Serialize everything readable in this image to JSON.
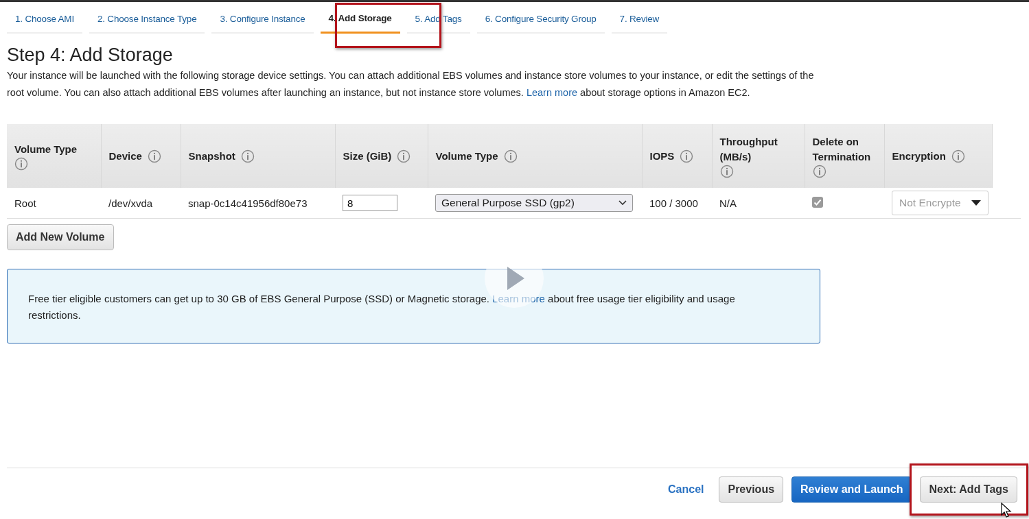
{
  "tabs": [
    {
      "label": "1. Choose AMI",
      "selected": false
    },
    {
      "label": "2. Choose Instance Type",
      "selected": false
    },
    {
      "label": "3. Configure Instance",
      "selected": false
    },
    {
      "label": "4. Add Storage",
      "selected": true
    },
    {
      "label": "5. Add Tags",
      "selected": false
    },
    {
      "label": "6. Configure Security Group",
      "selected": false
    },
    {
      "label": "7. Review",
      "selected": false
    }
  ],
  "title": "Step 4: Add Storage",
  "description": {
    "before": "Your instance will be launched with the following storage device settings. You can attach additional EBS volumes and instance store volumes to your instance, or edit the settings of the root volume. You can also attach additional EBS volumes after launching an instance, but not instance store volumes.",
    "link": "Learn more",
    "after": "about storage options in Amazon EC2."
  },
  "table": {
    "columns": [
      {
        "label": "Volume Type"
      },
      {
        "label": "Device"
      },
      {
        "label": "Snapshot"
      },
      {
        "label": "Size (GiB)"
      },
      {
        "label": "Volume Type"
      },
      {
        "label": "IOPS"
      },
      {
        "label": "Throughput (MB/s)"
      },
      {
        "label": "Delete on Termination"
      },
      {
        "label": "Encryption"
      }
    ],
    "rows": [
      {
        "volume_type": "Root",
        "device": "/dev/xvda",
        "snapshot": "snap-0c14c41956df80e73",
        "size": "8",
        "type_select": "General Purpose SSD (gp2)",
        "iops": "100 / 3000",
        "throughput": "N/A",
        "delete_on_termination": true,
        "encryption": "Not Encrypte"
      }
    ]
  },
  "add_volume_button": "Add New Volume",
  "notice": {
    "before": "Free tier eligible customers can get up to 30 GB of EBS General Purpose (SSD) or Magnetic storage.",
    "link": "Learn more",
    "after": "about free usage tier eligibility and usage restrictions."
  },
  "footer": {
    "cancel": "Cancel",
    "previous": "Previous",
    "review": "Review and Launch",
    "next": "Next: Add Tags"
  }
}
